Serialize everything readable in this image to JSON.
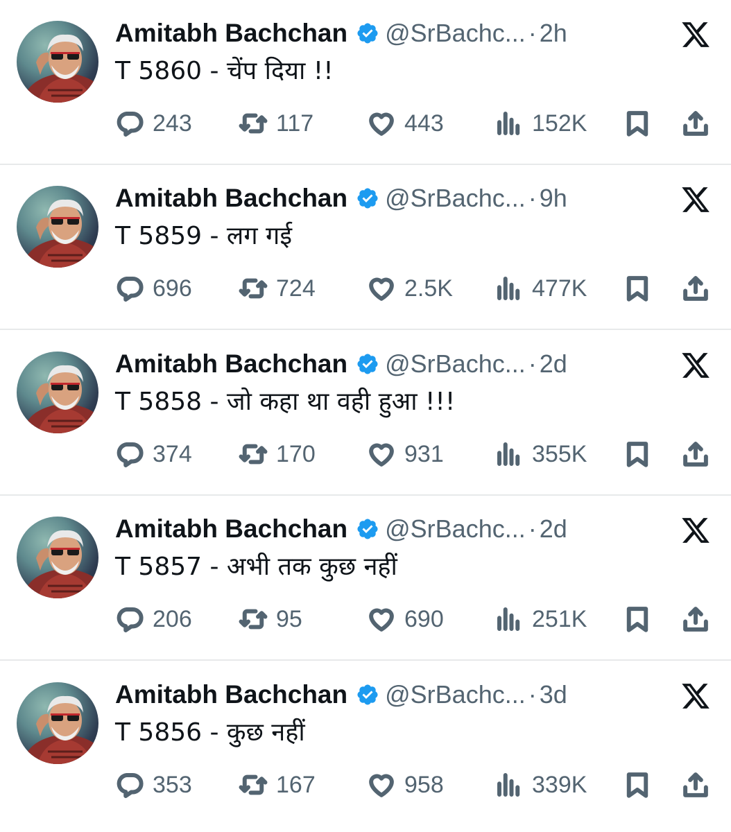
{
  "colors": {
    "text_primary": "#0f1419",
    "text_secondary": "#536471",
    "verified_blue": "#1d9bf0",
    "separator": "#e7e9ea"
  },
  "icons": {
    "reply": "speech-bubble-icon",
    "retweet": "retweet-arrows-icon",
    "like": "heart-icon",
    "views": "bar-chart-icon",
    "bookmark": "bookmark-icon",
    "share": "share-upload-icon",
    "platform": "x-logo-icon",
    "verified": "verified-badge-icon"
  },
  "tweets": [
    {
      "name": "Amitabh Bachchan",
      "handle": "@SrBachc...",
      "separator": "·",
      "time": "2h",
      "text": "T 5860 - चेंप  दिया  !!",
      "replies": "243",
      "retweets": "117",
      "likes": "443",
      "views": "152K"
    },
    {
      "name": "Amitabh Bachchan",
      "handle": "@SrBachc...",
      "separator": "·",
      "time": "9h",
      "text": "T 5859 - लग गई",
      "replies": "696",
      "retweets": "724",
      "likes": "2.5K",
      "views": "477K"
    },
    {
      "name": "Amitabh Bachchan",
      "handle": "@SrBachc...",
      "separator": "·",
      "time": "2d",
      "text": "T 5858 - जो कहा था वही हुआ  !!!",
      "replies": "374",
      "retweets": "170",
      "likes": "931",
      "views": "355K"
    },
    {
      "name": "Amitabh Bachchan",
      "handle": "@SrBachc...",
      "separator": "·",
      "time": "2d",
      "text": "T 5857 - अभी तक कुछ नहीं",
      "replies": "206",
      "retweets": "95",
      "likes": "690",
      "views": "251K"
    },
    {
      "name": "Amitabh Bachchan",
      "handle": "@SrBachc...",
      "separator": "·",
      "time": "3d",
      "text": "T 5856 - कुछ नहीं",
      "replies": "353",
      "retweets": "167",
      "likes": "958",
      "views": "339K"
    }
  ]
}
